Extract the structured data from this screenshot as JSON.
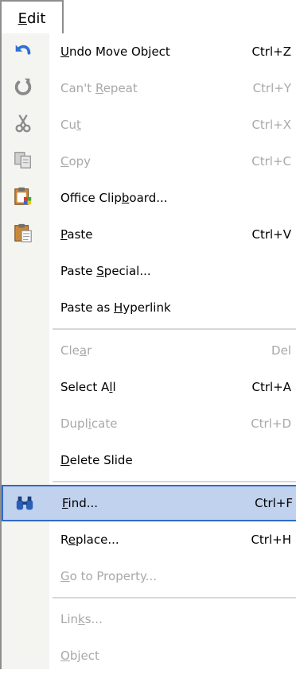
{
  "menu_title": {
    "pre": "",
    "mnemonic": "E",
    "post": "dit"
  },
  "items": [
    {
      "pre": "",
      "mn": "U",
      "post": "ndo Move Object",
      "shortcut": "Ctrl+Z"
    },
    {
      "pre": "Can't ",
      "mn": "R",
      "post": "epeat",
      "shortcut": "Ctrl+Y"
    },
    {
      "pre": "Cu",
      "mn": "t",
      "post": "",
      "shortcut": "Ctrl+X"
    },
    {
      "pre": "",
      "mn": "C",
      "post": "opy",
      "shortcut": "Ctrl+C"
    },
    {
      "pre": "Office Clip",
      "mn": "b",
      "post": "oard...",
      "shortcut": ""
    },
    {
      "pre": "",
      "mn": "P",
      "post": "aste",
      "shortcut": "Ctrl+V"
    },
    {
      "pre": "Paste ",
      "mn": "S",
      "post": "pecial...",
      "shortcut": ""
    },
    {
      "pre": "Paste as ",
      "mn": "H",
      "post": "yperlink",
      "shortcut": ""
    },
    {
      "pre": "Cle",
      "mn": "a",
      "post": "r",
      "shortcut": "Del"
    },
    {
      "pre": "Select A",
      "mn": "l",
      "post": "l",
      "shortcut": "Ctrl+A"
    },
    {
      "pre": "Dupl",
      "mn": "i",
      "post": "cate",
      "shortcut": "Ctrl+D"
    },
    {
      "pre": "",
      "mn": "D",
      "post": "elete Slide",
      "shortcut": ""
    },
    {
      "pre": "",
      "mn": "F",
      "post": "ind...",
      "shortcut": "Ctrl+F"
    },
    {
      "pre": "R",
      "mn": "e",
      "post": "place...",
      "shortcut": "Ctrl+H"
    },
    {
      "pre": "",
      "mn": "G",
      "post": "o to Property...",
      "shortcut": ""
    },
    {
      "pre": "Lin",
      "mn": "k",
      "post": "s...",
      "shortcut": ""
    },
    {
      "pre": "",
      "mn": "O",
      "post": "bject",
      "shortcut": ""
    }
  ],
  "colors": {
    "disabled_text": "#a8a8a8",
    "highlight_bg": "#c1d2ee",
    "highlight_border": "#316ac5",
    "gutter": "#f4f4f0"
  }
}
